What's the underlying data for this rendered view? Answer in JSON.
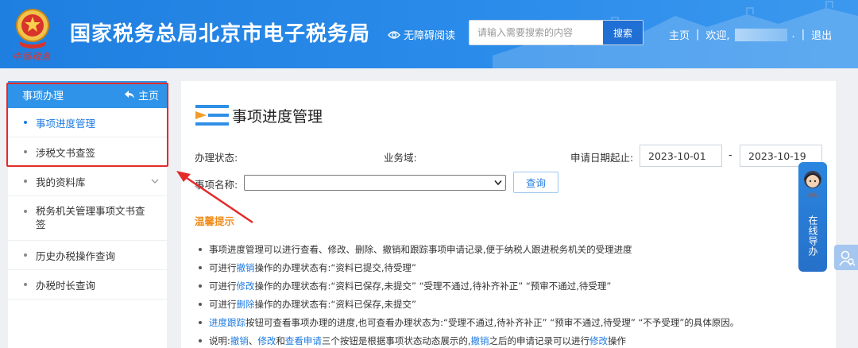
{
  "header": {
    "emblem_caption": "中国税务",
    "site_title": "国家税务总局北京市电子税务局",
    "accessibility_label": "无障碍阅读",
    "search": {
      "placeholder": "请输入需要搜索的内容",
      "button_label": "搜索"
    },
    "home_link": "主页",
    "separator": "|",
    "welcome": "欢迎,",
    "trailing_dot": ".",
    "logout": "退出"
  },
  "sidebar": {
    "section_title": "事项办理",
    "home_label": "主页",
    "items": [
      {
        "label": "事项进度管理",
        "active": true
      },
      {
        "label": "涉税文书查签",
        "active": false
      },
      {
        "label": "我的资料库",
        "active": false,
        "expandable": true
      },
      {
        "label_line1": "税务机关管理事项文书查",
        "label_line2": "签",
        "active": false
      },
      {
        "label": "历史办税操作查询",
        "active": false
      },
      {
        "label": "办税时长查询",
        "active": false
      }
    ]
  },
  "main": {
    "title": "事项进度管理",
    "form": {
      "status_label": "办理状态:",
      "domain_label": "业务域:",
      "date_label": "申请日期起止:",
      "date_from": "2023-10-01",
      "date_sep": "-",
      "date_to": "2023-10-19",
      "name_label": "事项名称:",
      "query_label": "查询"
    },
    "tips_title": "温馨提示",
    "tips": [
      {
        "segments": [
          {
            "text": "事项进度管理可以进行查看、修改、删除、撤销和跟踪事项申请记录,便于纳税人跟进税务机关的受理进度"
          }
        ]
      },
      {
        "segments": [
          {
            "text": "可进行"
          },
          {
            "text": "撤销",
            "hl": true
          },
          {
            "text": "操作的办理状态有:“资料已提交,待受理”"
          }
        ]
      },
      {
        "segments": [
          {
            "text": "可进行"
          },
          {
            "text": "修改",
            "hl": true
          },
          {
            "text": "操作的办理状态有:“资料已保存,未提交” “受理不通过,待补齐补正” “预审不通过,待受理”"
          }
        ]
      },
      {
        "segments": [
          {
            "text": "可进行"
          },
          {
            "text": "删除",
            "hl": true
          },
          {
            "text": "操作的办理状态有:“资料已保存,未提交”"
          }
        ]
      },
      {
        "segments": [
          {
            "text": "进度跟踪",
            "hl": true
          },
          {
            "text": "按钮可查看事项办理的进度,也可查看办理状态为:“受理不通过,待补齐补正” “预审不通过,待受理” “不予受理”的具体原因。"
          }
        ]
      },
      {
        "segments": [
          {
            "text": "说明:"
          },
          {
            "text": "撤销",
            "hl": true
          },
          {
            "text": "、"
          },
          {
            "text": "修改",
            "hl": true
          },
          {
            "text": "和"
          },
          {
            "text": "查看申请",
            "hl": true
          },
          {
            "text": "三个按钮是根据事项状态动态展示的,"
          },
          {
            "text": "撤销",
            "hl": true
          },
          {
            "text": "之后的申请记录可以进行"
          },
          {
            "text": "修改",
            "hl": true
          },
          {
            "text": "操作"
          }
        ]
      }
    ]
  },
  "float_widget": {
    "label": "在线导办"
  },
  "colors": {
    "header_blue": "#2a8bea",
    "accent_blue": "#1f7be0",
    "highlight_red": "#e52a2a",
    "tips_orange": "#f08c1a"
  }
}
